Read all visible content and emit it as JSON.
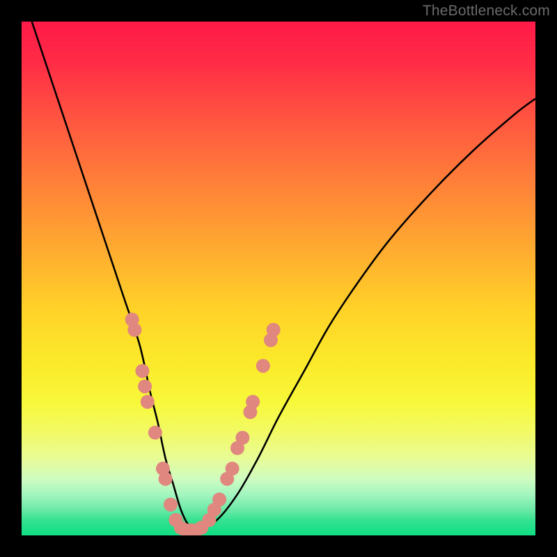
{
  "watermark": "TheBottleneck.com",
  "colors": {
    "frame": "#000000",
    "curve_stroke": "#000000",
    "marker_fill": "#e0877f",
    "gradient_top": "#ff1a49",
    "gradient_bottom": "#14dd84"
  },
  "chart_data": {
    "type": "line",
    "title": "",
    "xlabel": "",
    "ylabel": "",
    "xlim": [
      0,
      100
    ],
    "ylim": [
      0,
      100
    ],
    "grid": false,
    "series": [
      {
        "name": "bottleneck-curve",
        "x": [
          2,
          5,
          8,
          11,
          14,
          17,
          20,
          23,
          25,
          26.5,
          28,
          29.5,
          31,
          32.5,
          34,
          38,
          42,
          46,
          50,
          55,
          60,
          66,
          72,
          80,
          88,
          96,
          100
        ],
        "values": [
          100,
          91,
          82,
          73,
          64,
          55,
          46,
          37,
          28,
          22,
          15,
          10,
          5,
          2,
          1,
          3,
          8,
          15,
          23,
          32,
          41,
          50,
          58,
          67,
          75,
          82,
          85
        ]
      }
    ],
    "markers": [
      {
        "x": 21.5,
        "y": 42
      },
      {
        "x": 22.0,
        "y": 40
      },
      {
        "x": 23.5,
        "y": 32
      },
      {
        "x": 24.0,
        "y": 29
      },
      {
        "x": 24.5,
        "y": 26
      },
      {
        "x": 26.0,
        "y": 20
      },
      {
        "x": 27.5,
        "y": 13
      },
      {
        "x": 28.0,
        "y": 11
      },
      {
        "x": 29.0,
        "y": 6
      },
      {
        "x": 30.0,
        "y": 3
      },
      {
        "x": 31.0,
        "y": 1.5
      },
      {
        "x": 32.0,
        "y": 1
      },
      {
        "x": 33.0,
        "y": 1
      },
      {
        "x": 34.0,
        "y": 1
      },
      {
        "x": 35.0,
        "y": 1.5
      },
      {
        "x": 36.5,
        "y": 3
      },
      {
        "x": 37.5,
        "y": 5
      },
      {
        "x": 38.5,
        "y": 7
      },
      {
        "x": 40.0,
        "y": 11
      },
      {
        "x": 41.0,
        "y": 13
      },
      {
        "x": 42.0,
        "y": 17
      },
      {
        "x": 43.0,
        "y": 19
      },
      {
        "x": 44.5,
        "y": 24
      },
      {
        "x": 45.0,
        "y": 26
      },
      {
        "x": 47.0,
        "y": 33
      },
      {
        "x": 48.5,
        "y": 38
      },
      {
        "x": 49.0,
        "y": 40
      }
    ]
  }
}
